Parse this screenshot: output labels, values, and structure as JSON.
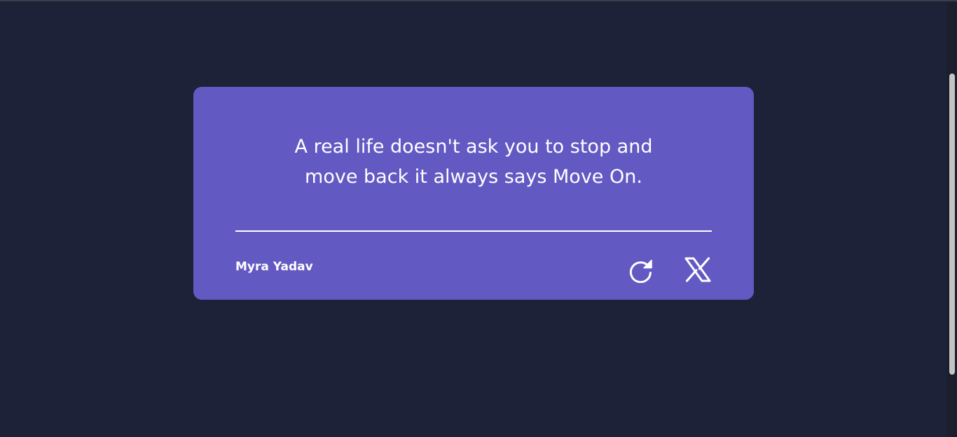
{
  "quote": {
    "line1": "A real life doesn't ask you to stop and",
    "line2": "move back it always says Move On."
  },
  "author": "Myra Yadav",
  "actions": {
    "new_quote_icon": "refresh-icon",
    "share_icon": "x-logo-icon"
  },
  "colors": {
    "background": "#1d2238",
    "card": "#6359c3",
    "text": "#ffffff"
  }
}
